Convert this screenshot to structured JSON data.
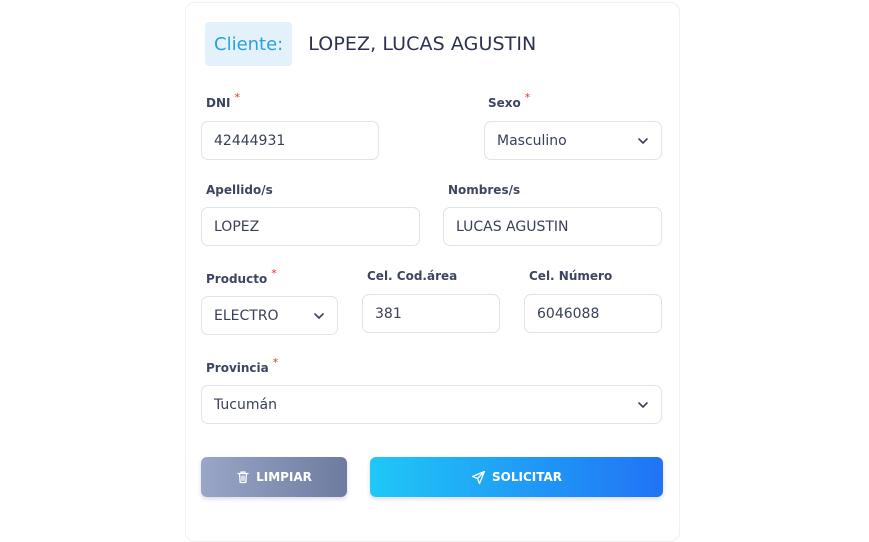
{
  "header": {
    "client_label": "Cliente:",
    "client_name": "LOPEZ, LUCAS AGUSTIN"
  },
  "form": {
    "dni": {
      "label": "DNI",
      "required": "*",
      "value": "42444931"
    },
    "sexo": {
      "label": "Sexo",
      "required": "*",
      "value": "Masculino"
    },
    "apellido": {
      "label": "Apellido/s",
      "value": "LOPEZ"
    },
    "nombres": {
      "label": "Nombres/s",
      "value": "LUCAS AGUSTIN"
    },
    "producto": {
      "label": "Producto",
      "required": "*",
      "value": "ELECTRO"
    },
    "cel_area": {
      "label": "Cel. Cod.área",
      "value": "381"
    },
    "cel_numero": {
      "label": "Cel. Número",
      "value": "6046088"
    },
    "provincia": {
      "label": "Provincia",
      "required": "*",
      "value": "Tucumán"
    }
  },
  "actions": {
    "clear_label": "LIMPIAR",
    "submit_label": "SOLICITAR"
  },
  "icons": {
    "clear": "trash-icon",
    "submit": "send-icon",
    "select": "chevron-down-icon"
  },
  "colors": {
    "accent": "#2ba0de",
    "required": "#e53030",
    "submit_start": "#1fc8f7",
    "submit_end": "#2173f5",
    "clear_start": "#9aa6c7",
    "clear_end": "#6d7ba0"
  }
}
